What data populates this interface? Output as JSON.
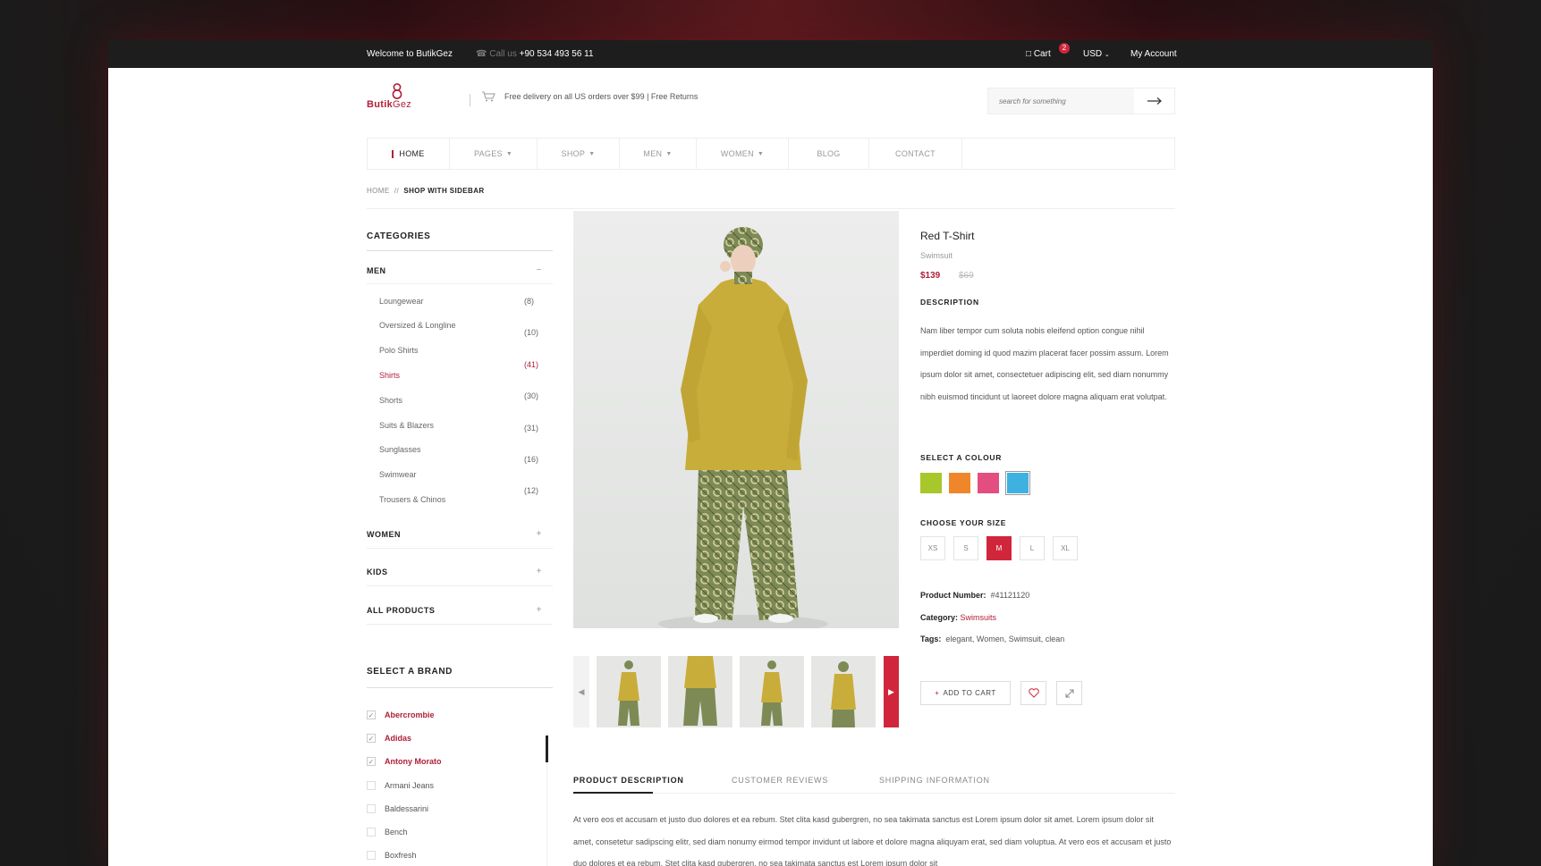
{
  "topbar": {
    "welcome": "Welcome to ButikGez",
    "call_label": "Call us",
    "phone": "+90 534 493 56 11",
    "cart_label": "Cart",
    "cart_count": "2",
    "currency": "USD",
    "account": "My Account"
  },
  "header": {
    "logo_prefix": "Butik",
    "logo_suffix": "Gez",
    "delivery": "Free delivery on all US orders over $99  |  Free Returns",
    "search_placeholder": "search for something"
  },
  "nav": [
    {
      "label": "HOME",
      "active": true
    },
    {
      "label": "PAGES",
      "dropdown": true
    },
    {
      "label": "SHOP",
      "dropdown": true
    },
    {
      "label": "MEN",
      "dropdown": true
    },
    {
      "label": "WOMEN",
      "dropdown": true
    },
    {
      "label": "BLOG"
    },
    {
      "label": "CONTACT"
    }
  ],
  "breadcrumb": {
    "home": "HOME",
    "sep": "//",
    "current": "SHOP WITH SIDEBAR"
  },
  "sidebar": {
    "categories_title": "CATEGORIES",
    "groups": [
      {
        "label": "MEN",
        "symbol": "−"
      },
      {
        "label": "WOMEN",
        "symbol": "+"
      },
      {
        "label": "KIDS",
        "symbol": "+"
      },
      {
        "label": "ALL PRODUCTS",
        "symbol": "+"
      }
    ],
    "men_items": [
      "Loungewear",
      "Oversized & Longline",
      "Polo Shirts",
      "Shirts",
      "Shorts",
      "Suits & Blazers",
      "Sunglasses",
      "Swimwear",
      "Trousers & Chinos"
    ],
    "men_counts": [
      "(8)",
      "(10)",
      "(41)",
      "(30)",
      "(31)",
      "(16)",
      "(12)"
    ],
    "highlighted_item": "Shirts",
    "brand_title": "SELECT A BRAND",
    "brands": [
      {
        "label": "Abercrombie",
        "checked": true
      },
      {
        "label": "Adidas",
        "checked": true
      },
      {
        "label": "Antony Morato",
        "checked": true
      },
      {
        "label": "Armani Jeans",
        "checked": false
      },
      {
        "label": "Baldessarini",
        "checked": false
      },
      {
        "label": "Bench",
        "checked": false
      },
      {
        "label": "Boxfresh",
        "checked": false
      }
    ]
  },
  "product": {
    "title": "Red T-Shirt",
    "category": "Swimsuit",
    "price": "$139",
    "old_price": "$69",
    "description_title": "DESCRIPTION",
    "description": "Nam liber tempor cum soluta nobis eleifend option congue nihil imperdiet doming id quod mazim placerat facer possim assum. Lorem ipsum dolor sit amet, consectetuer adipiscing elit, sed diam nonummy nibh euismod tincidunt ut laoreet dolore magna aliquam erat volutpat.",
    "colour_title": "SELECT A COLOUR",
    "colours": [
      "#a7c72a",
      "#f0862a",
      "#e34d80",
      "#3fb1e0"
    ],
    "selected_colour": "#3fb1e0",
    "size_title": "CHOOSE YOUR SIZE",
    "sizes": [
      "XS",
      "S",
      "M",
      "L",
      "XL"
    ],
    "selected_size": "M",
    "number_label": "Product Number:",
    "number": "#41121120",
    "category_label": "Category:",
    "category_value": "Swimsuits",
    "tags_label": "Tags:",
    "tags": "elegant, Women, Swimsuit, clean",
    "add_to_cart": "ADD TO CART",
    "plus": "+"
  },
  "tabs": {
    "items": [
      "PRODUCT DESCRIPTION",
      "CUSTOMER REVIEWS",
      "SHIPPING INFORMATION"
    ],
    "active": "PRODUCT DESCRIPTION",
    "body": "At vero eos et accusam et justo duo dolores et ea rebum. Stet clita kasd gubergren, no sea takimata sanctus est Lorem ipsum dolor sit amet. Lorem ipsum dolor sit amet, consetetur sadipscing elitr, sed diam nonumy eirmod tempor invidunt ut labore et dolore magna aliquyam erat, sed diam voluptua. At vero eos et accusam et justo duo dolores et ea rebum. Stet clita kasd gubergren, no sea takimata sanctus est Lorem ipsum dolor sit"
  },
  "colors": {
    "accent": "#b0203a",
    "badge": "#d0263b",
    "topbar": "#1d1d1d"
  }
}
